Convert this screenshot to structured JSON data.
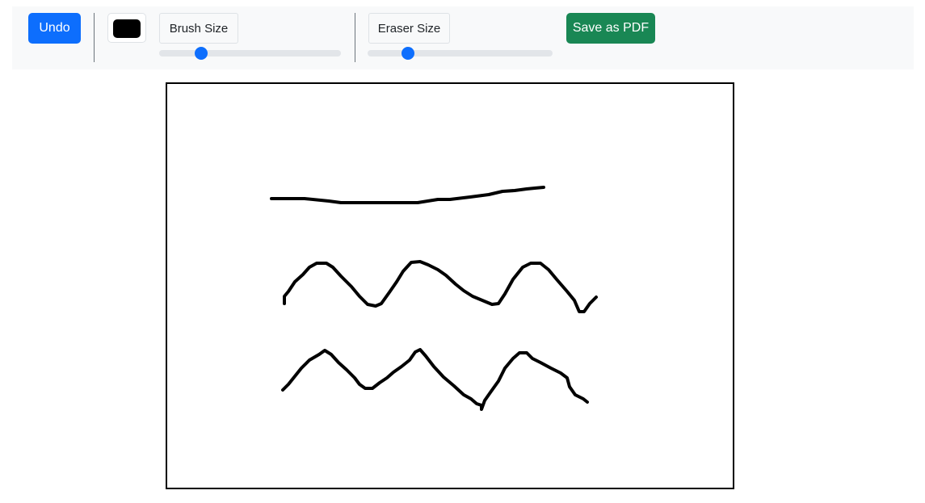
{
  "toolbar": {
    "undo_label": "Undo",
    "brush_color": "#000000",
    "brush_size_label": "Brush Size",
    "brush_size_value": 0.23,
    "eraser_size_label": "Eraser Size",
    "eraser_size_value": 0.22,
    "save_label": "Save as PDF"
  },
  "canvas": {
    "background": "#ffffff",
    "stroke_color": "#000000",
    "strokes": [
      "M 129 142 L 170 142 L 200 145 L 215 147 L 230 147 L 305 147 L 310 147 L 335 143 L 350 143 L 375 140 L 398 137 L 415 133 L 430 132 L 445 130 L 455 129 L 466 128",
      "M 145 272 L 145 263 L 150 257 L 158 245 L 168 236 L 176 227 L 185 222 L 197 222 L 205 227 L 215 238 L 228 251 L 238 263 L 248 273 L 258 275 L 265 272 L 275 258 L 284 245 L 292 232 L 302 221 L 313 220 L 323 224 L 335 230 L 345 237 L 357 248 L 367 256 L 378 263 L 390 268 L 402 273 L 410 272 L 418 260 L 428 242 L 440 227 L 450 222 L 462 222 L 472 230 L 482 242 L 495 257 L 504 268 L 510 282 L 516 282 L 523 272 L 531 264",
      "M 143 379 L 150 372 L 158 362 L 166 352 L 176 342 L 188 335 L 195 330 L 203 335 L 212 345 L 222 354 L 232 364 L 238 372 L 245 377 L 254 377 L 263 370 L 272 364 L 280 357 L 290 350 L 300 342 L 307 332 L 313 329 L 320 337 L 330 350 L 342 363 L 355 374 L 367 385 L 376 390 L 383 396 L 389 398 L 389 403 L 393 392 L 400 382 L 410 368 L 418 352 L 428 340 L 436 333 L 445 333 L 452 340 L 462 345 L 475 352 L 487 358 L 495 364 L 498 375 L 505 385 L 515 390 L 520 394"
    ]
  }
}
